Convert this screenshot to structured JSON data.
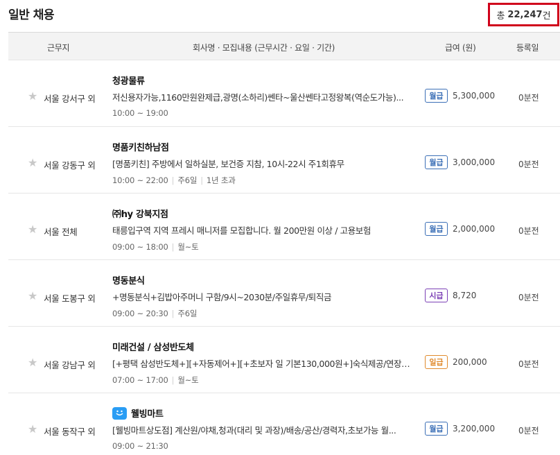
{
  "header": {
    "title": "일반 채용",
    "total_prefix": "총",
    "total_count": "22,247",
    "total_suffix": "건"
  },
  "table": {
    "columns": {
      "location": "근무지",
      "company": "회사명 · 모집내용 (근무시간 · 요일 · 기간)",
      "pay": "급여 (원)",
      "registered": "등록일"
    },
    "rows": [
      {
        "location": "서울 강서구 외",
        "company": "청광물류",
        "description": "저신용자가능,1160만원완제급,광명(소하리)쎈타~울산쎈타고정왕복(역순도가능)...",
        "time": "10:00 ~ 19:00",
        "days": "",
        "period": "",
        "pay_type": "월급",
        "amount": "5,300,000",
        "registered": "0분전"
      },
      {
        "location": "서울 강동구 외",
        "company": "명품키친하남점",
        "description": "[명품키친] 주방에서 일하실분, 보건증 지참, 10시-22시 주1회휴무",
        "time": "10:00 ~ 22:00",
        "days": "주6일",
        "period": "1년 초과",
        "pay_type": "월급",
        "amount": "3,000,000",
        "registered": "0분전"
      },
      {
        "location": "서울 전체",
        "company": "㈜hy 강북지점",
        "description": "태릉입구역 지역 프레시 매니저를 모집합니다. 월 200만원 이상 / 고용보험",
        "time": "09:00 ~ 18:00",
        "days": "월~토",
        "period": "",
        "pay_type": "월급",
        "amount": "2,000,000",
        "registered": "0분전"
      },
      {
        "location": "서울 도봉구 외",
        "company": "명동분식",
        "description": "+명동분식+김밥아주머니 구함/9시~2030분/주일휴무/퇴직금",
        "time": "09:00 ~ 20:30",
        "days": "주6일",
        "period": "",
        "pay_type": "시급",
        "amount": "8,720",
        "registered": "0분전"
      },
      {
        "location": "서울 강남구 외",
        "company": "미래건설 / 삼성반도체",
        "description": "[+평택 삼성반도체+][+자동제어+][+초보자 일 기본130,000원+]숙식제공/연장,야...",
        "time": "07:00 ~ 17:00",
        "days": "월~토",
        "period": "",
        "pay_type": "일급",
        "amount": "200,000",
        "registered": "0분전"
      },
      {
        "location": "서울 동작구 외",
        "company": "웰빙마트",
        "description": "[웰빙마트상도점] 계산원/야채,청과(대리 및 과장)/배송/공산/경력자,초보가능 월...",
        "time": "09:00 ~ 21:30",
        "days": "",
        "period": "",
        "pay_type": "월급",
        "amount": "3,200,000",
        "registered": "0분전"
      }
    ]
  },
  "icons": {
    "star": "star-icon",
    "company_logo": "smiley-logo-icon"
  },
  "colors": {
    "highlight_border": "#d0021b",
    "monthly": "#3b6fb6",
    "hourly": "#7b3fb5",
    "daily": "#e08a2c",
    "logo": "#2a9df4"
  }
}
